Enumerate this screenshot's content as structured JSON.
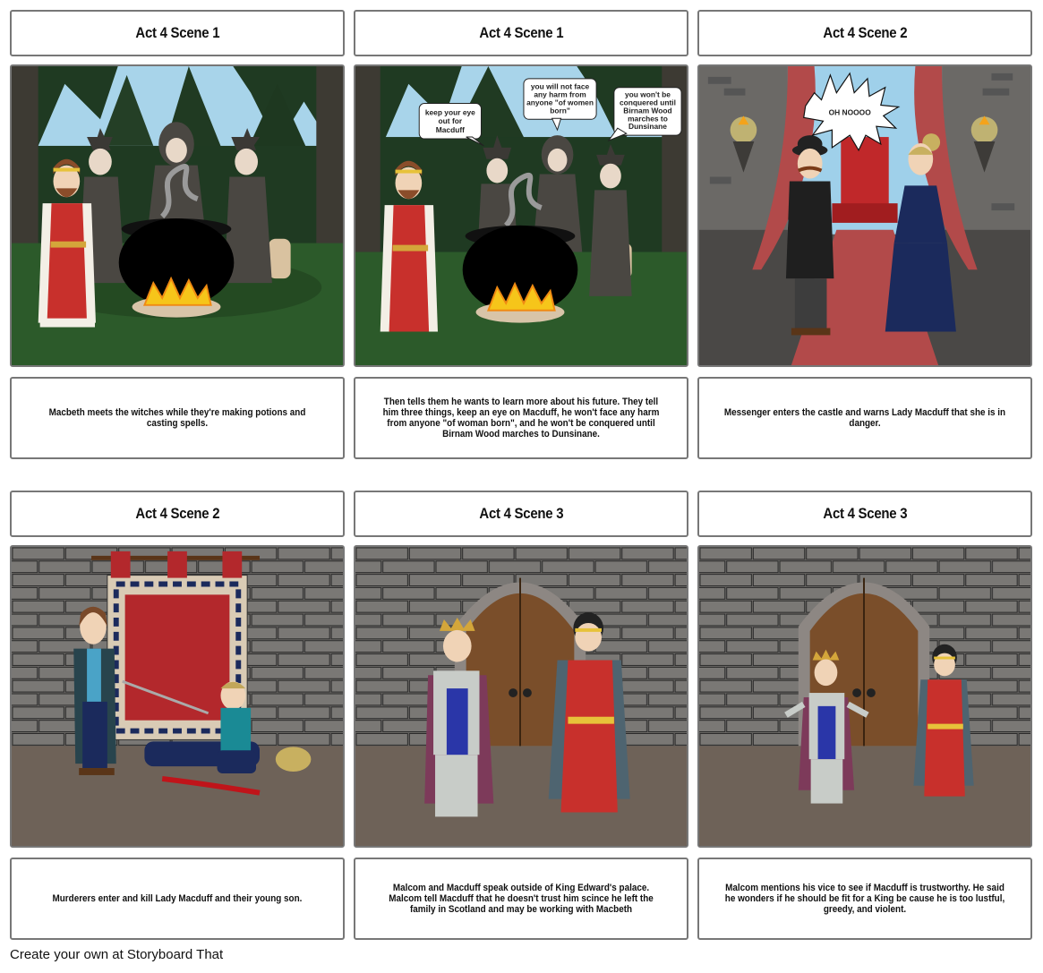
{
  "storyboard": {
    "cells": [
      {
        "title": "Act 4 Scene 1",
        "scene": "forest-witches-cauldron",
        "description": "Macbeth meets the witches while they're making potions and casting spells.",
        "bubbles": []
      },
      {
        "title": "Act 4 Scene 1",
        "scene": "forest-witches-prophecy",
        "description": "Then tells them he wants to learn more about his future. They tell him three things, keep an eye on Macduff, he won't face any harm from anyone \"of woman born\", and he won't be conquered until Birnam Wood marches to Dunsinane.",
        "bubbles": [
          "keep your eye out for Macduff",
          "you will not face any harm from anyone \"of women born\"",
          "you won't be conquered until Birnam Wood marches to Dunsinane"
        ]
      },
      {
        "title": "Act 4 Scene 2",
        "scene": "castle-throne-room",
        "description": "Messenger enters the castle and warns Lady Macduff that she is in danger.",
        "bubbles": [
          "OH NOOOO"
        ]
      },
      {
        "title": "Act 4 Scene 2",
        "scene": "castle-wall-tapestry",
        "description": "Murderers enter and kill Lady Macduff and their young son.",
        "bubbles": []
      },
      {
        "title": "Act 4 Scene 3",
        "scene": "palace-door",
        "description": "Malcom and Macduff speak outside of King Edward's palace. Malcom tell Macduff that he doesn't trust him scince he left the family in Scotland and may be working with Macbeth",
        "bubbles": []
      },
      {
        "title": "Act 4 Scene 3",
        "scene": "palace-door",
        "description": "Malcom mentions his vice to see if Macduff is trustworthy. He said he wonders if he should be fit for a King be cause he is too lustful, greedy, and violent.",
        "bubbles": []
      }
    ]
  },
  "footer": {
    "text": "Create your own at Storyboard That"
  },
  "colors": {
    "border": "#777777",
    "forest_dark": "#1f3a1f",
    "sky": "#a8d4ea",
    "stone_wall": "#6b6966",
    "floor": "#6e6258",
    "curtain_red": "#b24a4a",
    "robe_red": "#c8302c",
    "door_wood": "#7a4e2a"
  }
}
